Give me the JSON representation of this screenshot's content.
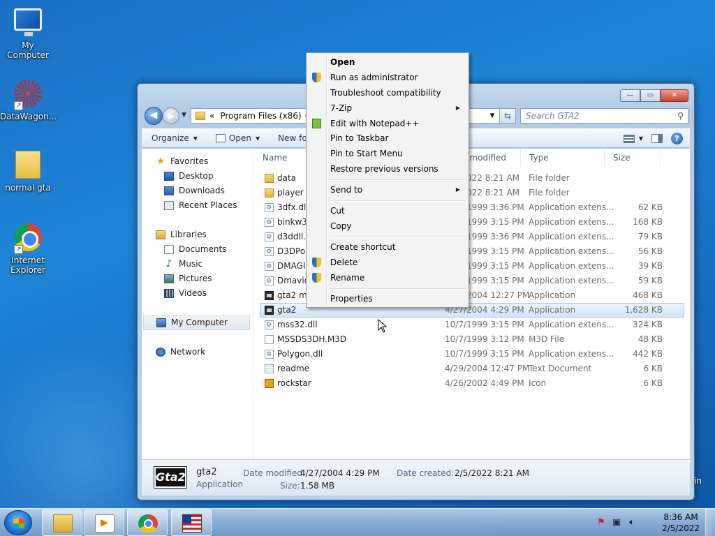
{
  "desktop": {
    "icons": [
      {
        "label": "My Computer",
        "icon": "computer-icon"
      },
      {
        "label": "DataWagon...",
        "icon": "datawagon-icon"
      },
      {
        "label": "normal gta",
        "icon": "folder-icon"
      },
      {
        "label": "Internet Explorer",
        "icon": "chrome-icon"
      }
    ],
    "partial_text": "in"
  },
  "window": {
    "controls": {
      "minimize": "—",
      "maximize": "▭",
      "close": "✕"
    },
    "address": {
      "prefix": "«",
      "path": "Program Files (x86)",
      "sep": "▸"
    },
    "search_placeholder": "Search GTA2",
    "toolbar": {
      "organize": "Organize",
      "open": "Open",
      "new_folder": "New folder"
    },
    "nav": {
      "favorites": "Favorites",
      "desktop": "Desktop",
      "downloads": "Downloads",
      "recent": "Recent Places",
      "libraries": "Libraries",
      "documents": "Documents",
      "music": "Music",
      "pictures": "Pictures",
      "videos": "Videos",
      "computer": "My Computer",
      "network": "Network"
    },
    "columns": {
      "name": "Name",
      "date": "Date modified",
      "type": "Type",
      "size": "Size"
    },
    "files": [
      {
        "name": "data",
        "date": "2/5/2022 8:21 AM",
        "type": "File folder",
        "size": "",
        "icon": "folder"
      },
      {
        "name": "player",
        "date": "2/5/2022 8:21 AM",
        "type": "File folder",
        "size": "",
        "icon": "folder"
      },
      {
        "name": "3dfx.dll",
        "date": "10/7/1999 3:36 PM",
        "type": "Application extens...",
        "size": "62 KB",
        "icon": "dll"
      },
      {
        "name": "binkw32.dll",
        "date": "10/7/1999 3:15 PM",
        "type": "Application extens...",
        "size": "168 KB",
        "icon": "dll"
      },
      {
        "name": "d3ddll.dll",
        "date": "10/7/1999 3:36 PM",
        "type": "Application extens...",
        "size": "79 KB",
        "icon": "dll"
      },
      {
        "name": "D3DPoly.dll",
        "date": "10/7/1999 3:15 PM",
        "type": "Application extens...",
        "size": "56 KB",
        "icon": "dll"
      },
      {
        "name": "DMAGIC.dll",
        "date": "10/7/1999 3:15 PM",
        "type": "Application extens...",
        "size": "39 KB",
        "icon": "dll"
      },
      {
        "name": "Dmavideo.dll",
        "date": "10/7/1999 3:15 PM",
        "type": "Application extens...",
        "size": "59 KB",
        "icon": "dll"
      },
      {
        "name": "gta2 manager",
        "date": "4/29/2004 12:27 PM",
        "type": "Application",
        "size": "468 KB",
        "icon": "app"
      },
      {
        "name": "gta2",
        "date": "4/27/2004 4:29 PM",
        "type": "Application",
        "size": "1,628 KB",
        "icon": "app",
        "selected": true
      },
      {
        "name": "mss32.dll",
        "date": "10/7/1999 3:15 PM",
        "type": "Application extens...",
        "size": "324 KB",
        "icon": "dll"
      },
      {
        "name": "MSSDS3DH.M3D",
        "date": "10/7/1999 3:12 PM",
        "type": "M3D File",
        "size": "48 KB",
        "icon": "m3d"
      },
      {
        "name": "Polygon.dll",
        "date": "10/7/1999 3:15 PM",
        "type": "Application extens...",
        "size": "442 KB",
        "icon": "dll"
      },
      {
        "name": "readme",
        "date": "4/29/2004 12:47 PM",
        "type": "Text Document",
        "size": "6 KB",
        "icon": "txt"
      },
      {
        "name": "rockstar",
        "date": "4/26/2002 4:49 PM",
        "type": "Icon",
        "size": "6 KB",
        "icon": "ico"
      }
    ],
    "details": {
      "logo": "Gta2",
      "name": "gta2",
      "kind": "Application",
      "date_modified_label": "Date modified:",
      "date_modified": "4/27/2004 4:29 PM",
      "size_label": "Size:",
      "size": "1.58 MB",
      "date_created_label": "Date created:",
      "date_created": "2/5/2022 8:21 AM"
    }
  },
  "context_menu": {
    "open": "Open",
    "run_admin": "Run as administrator",
    "troubleshoot": "Troubleshoot compatibility",
    "seven_zip": "7-Zip",
    "notepad": "Edit with Notepad++",
    "pin_taskbar": "Pin to Taskbar",
    "pin_start": "Pin to Start Menu",
    "restore": "Restore previous versions",
    "send_to": "Send to",
    "cut": "Cut",
    "copy": "Copy",
    "create_shortcut": "Create shortcut",
    "delete": "Delete",
    "rename": "Rename",
    "properties": "Properties",
    "arrow": "▶"
  },
  "taskbar": {
    "time": "8:36 AM",
    "date": "2/5/2022"
  }
}
